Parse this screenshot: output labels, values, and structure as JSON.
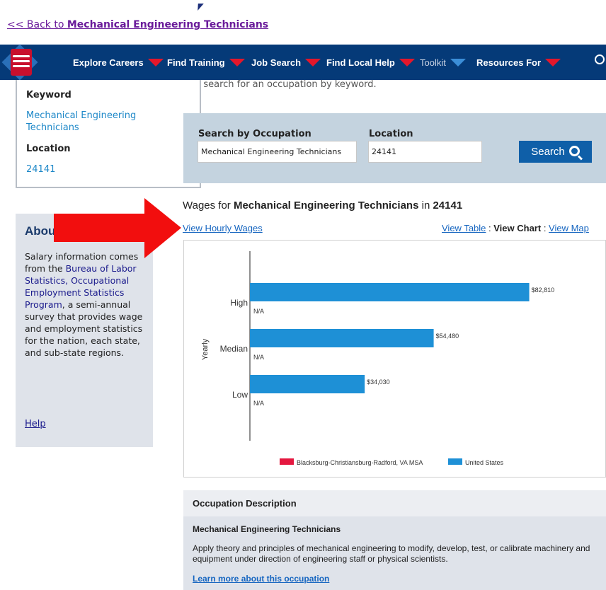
{
  "back_link": {
    "prefix": "<< Back to ",
    "target": "Mechanical Engineering Technicians"
  },
  "nav": {
    "items": [
      {
        "label": "Explore Careers",
        "arrow_color": "#e4172b"
      },
      {
        "label": "Find Training",
        "arrow_color": "#e4172b"
      },
      {
        "label": "Job Search",
        "arrow_color": "#e4172b"
      },
      {
        "label": "Find Local Help",
        "arrow_color": "#e4172b"
      },
      {
        "label": "Toolkit",
        "arrow_color": "#3b8ed8"
      },
      {
        "label": "Resources For",
        "arrow_color": "#e4172b"
      }
    ],
    "background": "#053a78"
  },
  "intro_text": "t, search for an occupation by keyword.",
  "sidebar": {
    "keyword_label": "Keyword",
    "keyword_value": "Mechanical Engineering Technicians",
    "location_label": "Location",
    "location_value": "24141"
  },
  "search": {
    "occupation_label": "Search by Occupation",
    "occupation_value": "Mechanical Engineering Technicians",
    "location_label": "Location",
    "location_value": "24141",
    "button_label": "Search"
  },
  "wages": {
    "prefix": "Wages for ",
    "occupation": "Mechanical Engineering Technicians",
    "middle": " in ",
    "location": "24141",
    "hourly_link": "View Hourly Wages",
    "view_table": "View Table",
    "separator": " : ",
    "view_chart": "View Chart",
    "view_map": "View Map"
  },
  "about": {
    "title": "About",
    "text_before": "Salary information comes from the ",
    "link_text": "Bureau of Labor Statistics, Occupational Employment Statistics Program",
    "text_after": ", a semi-annual survey that provides wage and employment statistics for the nation, each state, and sub-state regions.",
    "help": "Help"
  },
  "chart_data": {
    "type": "bar",
    "orientation": "horizontal",
    "ylabel": "Yearly",
    "categories": [
      "High",
      "Median",
      "Low"
    ],
    "series": [
      {
        "name": "Blacksburg-Christiansburg-Radford, VA MSA",
        "color": "#e4173f",
        "values": [
          null,
          null,
          null
        ],
        "labels": [
          "N/A",
          "N/A",
          "N/A"
        ]
      },
      {
        "name": "United States",
        "color": "#1e90d6",
        "values": [
          82810,
          54480,
          34030
        ],
        "labels": [
          "$82,810",
          "$54,480",
          "$34,030"
        ]
      }
    ],
    "xlim": [
      0,
      85000
    ],
    "grid": false,
    "legend": "bottom"
  },
  "occupation": {
    "header": "Occupation Description",
    "name": "Mechanical Engineering Technicians",
    "description": "Apply theory and principles of mechanical engineering to modify, develop, test, or calibrate machinery and equipment under direction of engineering staff or physical scientists.",
    "learn_more": "Learn more about this occupation"
  }
}
